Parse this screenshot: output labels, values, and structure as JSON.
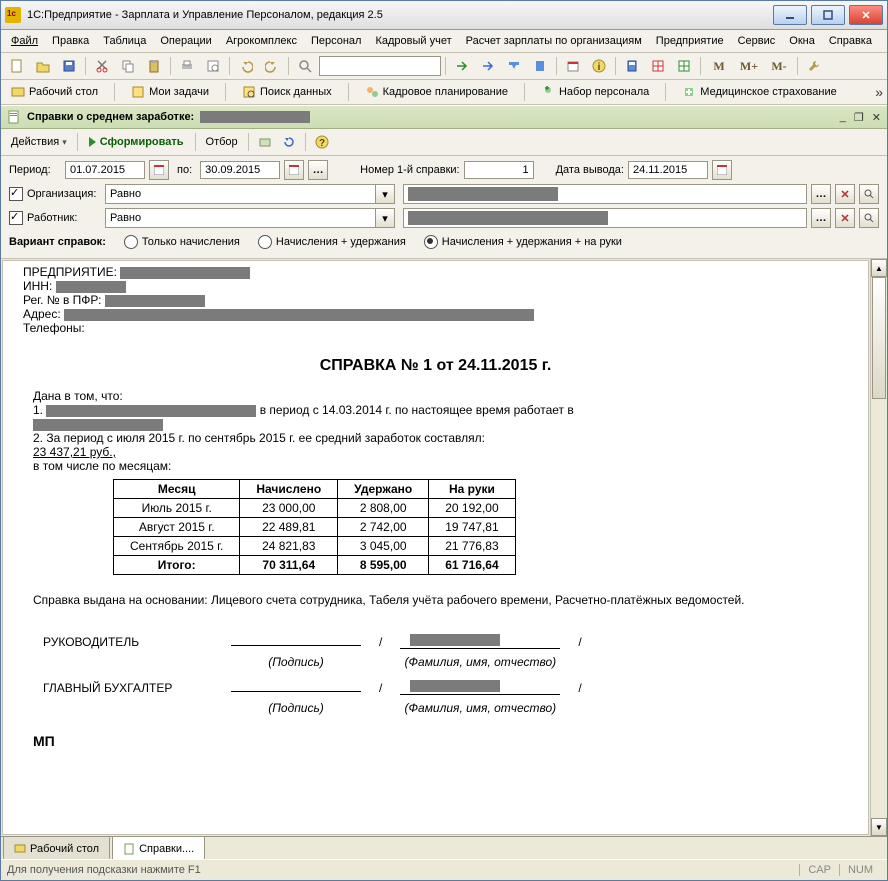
{
  "titlebar": {
    "title": "1С:Предприятие - Зарплата и Управление Персоналом, редакция 2.5"
  },
  "menubar": [
    "Файл",
    "Правка",
    "Таблица",
    "Операции",
    "Агрокомплекс",
    "Персонал",
    "Кадровый учет",
    "Расчет зарплаты по организациям",
    "Предприятие",
    "Сервис",
    "Окна",
    "Справка"
  ],
  "subbar": {
    "items": [
      "Рабочий стол",
      "Мои задачи",
      "Поиск данных",
      "Кадровое планирование",
      "Набор персонала",
      "Медицинское страхование"
    ]
  },
  "docbar": {
    "title": "Справки о среднем заработке:"
  },
  "actbar": {
    "actions_label": "Действия",
    "run_label": "Сформировать",
    "filter_label": "Отбор"
  },
  "filters": {
    "period_label": "Период:",
    "period_from": "01.07.2015",
    "period_to_label": "по:",
    "period_to": "30.09.2015",
    "ref_no_label": "Номер 1-й справки:",
    "ref_no": "1",
    "output_date_label": "Дата вывода:",
    "output_date": "24.11.2015",
    "org_label": "Организация:",
    "org_op": "Равно",
    "emp_label": "Работник:",
    "emp_op": "Равно",
    "variant_label": "Вариант справок:",
    "variant_opts": [
      "Только начисления",
      "Начисления + удержания",
      "Начисления + удержания + на руки"
    ],
    "variant_selected": 2
  },
  "report": {
    "org_label": "ПРЕДПРИЯТИЕ:",
    "inn_label": "ИНН:",
    "pfr_label": "Рег. № в ПФР:",
    "addr_label": "Адрес:",
    "phones_label": "Телефоны:",
    "title": "СПРАВКА № 1 от 24.11.2015 г.",
    "p_intro": "Дана в том, что:",
    "p1_num": "1.",
    "p1_tail": "в период с 14.03.2014 г. по настоящее время работает в",
    "p2": "2. За период с июля 2015  г. по сентябрь 2015  г.  ее средний заработок составлял:",
    "avg": "23 437,21 руб.,",
    "p_by_month": "в том числе по месяцам:",
    "table": {
      "headers": [
        "Месяц",
        "Начислено",
        "Удержано",
        "На руки"
      ],
      "rows": [
        [
          "Июль 2015 г.",
          "23 000,00",
          "2 808,00",
          "20 192,00"
        ],
        [
          "Август 2015 г.",
          "22 489,81",
          "2 742,00",
          "19 747,81"
        ],
        [
          "Сентябрь 2015 г.",
          "24 821,83",
          "3 045,00",
          "21 776,83"
        ]
      ],
      "total": [
        "Итого:",
        "70 311,64",
        "8 595,00",
        "61 716,64"
      ]
    },
    "basis": "Справка выдана на основании: Лицевого счета сотрудника, Табеля учёта рабочего времени, Расчетно-платёжных ведомостей.",
    "sig_head": "РУКОВОДИТЕЛЬ",
    "sig_acc": "ГЛАВНЫЙ БУХГАЛТЕР",
    "sig_sign": "(Подпись)",
    "sig_fio": "(Фамилия, имя, отчество)",
    "mp": "МП"
  },
  "bottom_tabs": {
    "desk": "Рабочий стол",
    "doc": "Справки...."
  },
  "statusbar": {
    "hint": "Для получения подсказки нажмите F1",
    "cap": "CAP",
    "num": "NUM"
  }
}
